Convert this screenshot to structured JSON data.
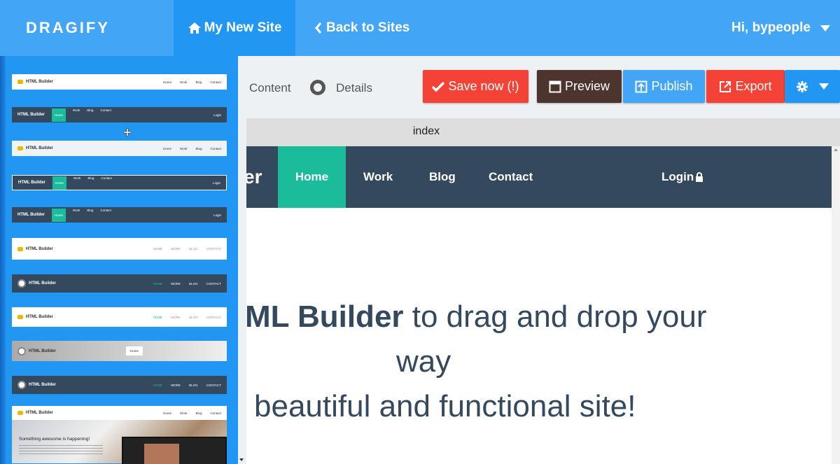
{
  "header": {
    "brand": "DRAGIFY",
    "my_site": "My New Site",
    "back": "Back to Sites",
    "user": "Hi, bypeople"
  },
  "sidebar": {
    "thumbs": [
      {
        "logo": "HTML Builder",
        "menu": [
          "Home",
          "Work",
          "Blog",
          "Contact"
        ]
      },
      {
        "logo": "HTML Builder",
        "menu": [
          "Home",
          "Work",
          "Blog",
          "Contact"
        ],
        "right": "Login"
      },
      {
        "logo": "HTML Builder",
        "menu": [
          "Home",
          "Work",
          "Blog",
          "Contact"
        ]
      },
      {
        "logo": "HTML Builder",
        "menu": [
          "Home",
          "Work",
          "Blog",
          "Contact"
        ],
        "right": "Login"
      },
      {
        "logo": "HTML Builder",
        "menu": [
          "Home",
          "Work",
          "Blog",
          "Contact"
        ],
        "right": "Login"
      },
      {
        "logo": "HTML Builder",
        "menu": [
          "HOME",
          "WORK",
          "BLOG",
          "CONTACT"
        ]
      },
      {
        "logo": "HTML Builder",
        "menu": [
          "HOME",
          "WORK",
          "BLOG",
          "CONTACT"
        ]
      },
      {
        "logo": "HTML Builder",
        "menu": [
          "HOME",
          "WORK",
          "BLOG",
          "CONTACT"
        ]
      },
      {
        "logo": "HTML Builder",
        "button": "Home"
      },
      {
        "logo": "HTML Builder",
        "menu": [
          "HOME",
          "WORK",
          "BLOG",
          "CONTACT"
        ]
      },
      {
        "logo": "HTML Builder",
        "menu": [
          "Home",
          "Work",
          "Blog",
          "Contact"
        ],
        "hero": "Something awesome is happening!"
      }
    ]
  },
  "toolbar": {
    "content_tab": "Content",
    "details_tab": "Details",
    "save": "Save now (!)",
    "preview": "Preview",
    "publish": "Publish",
    "export": "Export"
  },
  "page_tab": "index",
  "site": {
    "logo_fragment": "er",
    "nav": [
      "Home",
      "Work",
      "Blog",
      "Contact"
    ],
    "login": "Login",
    "headline_bold": "ML Builder",
    "headline_rest": " to drag and drop your",
    "headline_line2": "way",
    "headline_line3": "beautiful and functional site!"
  },
  "colors": {
    "topbar": "#42a5f5",
    "sidebar": "#2196f3",
    "site_nav": "#34495e",
    "site_active": "#1abc9c",
    "save": "#f44336",
    "preview": "#4e342e"
  }
}
